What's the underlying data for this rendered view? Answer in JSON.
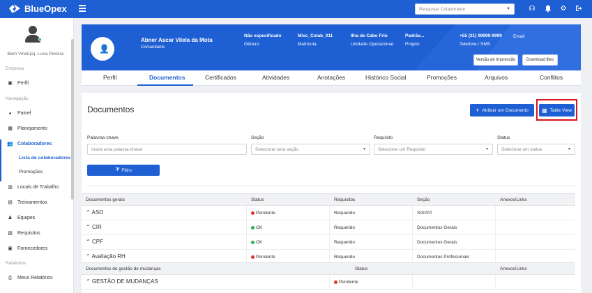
{
  "app": {
    "name": "BlueOpex"
  },
  "search": {
    "placeholder": "Pesquisar Colaborador"
  },
  "sidebar": {
    "welcome": "Bem Vindo(a), Luna Pereira",
    "sections": {
      "empresa": "Empresa",
      "navegacao": "Navegação",
      "relatorios": "Relatórios"
    },
    "items": {
      "perfil": "Perfil",
      "painel": "Painel",
      "planejamento": "Planejamento",
      "colaboradores": "Colaboradores",
      "lista": "Lista de colaboradores",
      "promocoes": "Promoções",
      "locais": "Locais de Trabalho",
      "treinamentos": "Treinamentos",
      "equipes": "Equipes",
      "requisitos": "Requisitos",
      "fornecedores": "Fornecedores",
      "meus_relatorios": "Meus Relatórios"
    }
  },
  "profile": {
    "name": "Abner Ascar Vilela da Mota",
    "role": "Comandante",
    "fields": [
      {
        "value": "Não especificado",
        "label": "Gênero"
      },
      {
        "value": "Misc_Colab_011",
        "label": "Matrícula"
      },
      {
        "value": "Ilha de Cabo Frio",
        "label": "Unidade Operacional"
      },
      {
        "value": "Padrão...",
        "label": "Projeto"
      },
      {
        "value": "+55 (21) 99999-9999",
        "label": "Telefone / SMS"
      },
      {
        "value": "Email",
        "label": ""
      }
    ],
    "print_label": "Versão de Impressão",
    "download_label": "Download files"
  },
  "tabs": [
    "Perfil",
    "Documentos",
    "Certificados",
    "Atividades",
    "Anotações",
    "Histórico Social",
    "Promoções",
    "Arquivos",
    "Conflitos"
  ],
  "documents": {
    "title": "Documentos",
    "assign_label": "Atribuir um Documento",
    "table_view_label": "Table View",
    "filters": {
      "keywords_label": "Palavras-chave",
      "keywords_placeholder": "Insira uma palavra-chave",
      "section_label": "Seção",
      "section_placeholder": "Selecione uma seção",
      "requirement_label": "Requisito",
      "requirement_placeholder": "Selecione um Requisito",
      "status_label": "Status",
      "status_placeholder": "Selecione um status",
      "filter_button": "Filtro"
    },
    "general": {
      "headers": [
        "Documentos gerais",
        "Status",
        "Requisitos",
        "Seção",
        "Anexos/Links"
      ],
      "rows": [
        {
          "name": "ASO",
          "status": "Pendente",
          "status_color": "#e0342b",
          "requirement": "Requerido",
          "section": "SISPAT"
        },
        {
          "name": "CIR",
          "status": "OK",
          "status_color": "#2bb24c",
          "requirement": "Requerido",
          "section": "Documentos Gerais"
        },
        {
          "name": "CPF",
          "status": "OK",
          "status_color": "#2bb24c",
          "requirement": "Requerido",
          "section": "Documentos Gerais"
        },
        {
          "name": "Avaliação RH",
          "status": "Pendente",
          "status_color": "#e0342b",
          "requirement": "Requerido",
          "section": "Documentos Profissionais"
        }
      ]
    },
    "change": {
      "headers": [
        "Documentos de gestão de mudanças",
        "Status",
        "Anexos/Links"
      ],
      "rows": [
        {
          "name": "GESTÃO DE MUDANÇAS",
          "status": "Pendente",
          "status_color": "#e0342b"
        }
      ]
    }
  },
  "colors": {
    "brand": "#1e5fd3",
    "highlight": "#d9141c"
  }
}
